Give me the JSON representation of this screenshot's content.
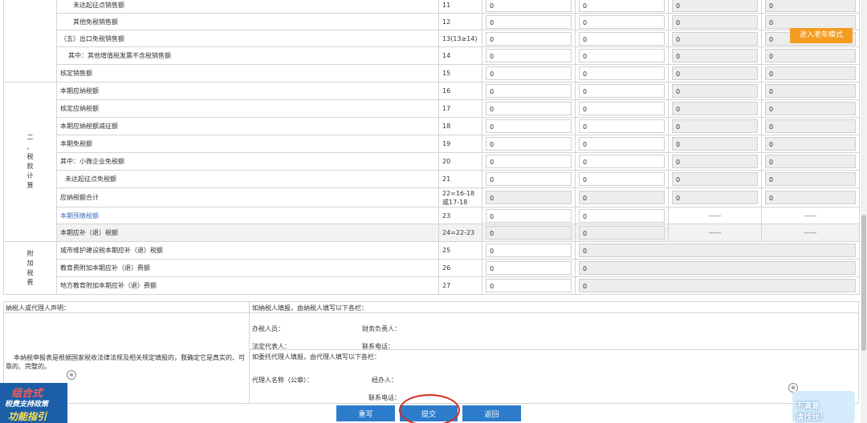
{
  "rows": [
    {
      "label": "未达起征点销售额",
      "indent": "ind1",
      "line": "11",
      "v1": "0",
      "v2": "0",
      "v3": "0",
      "v4": "0"
    },
    {
      "label": "其他免税销售额",
      "indent": "ind1",
      "line": "12",
      "v1": "0",
      "v2": "0",
      "v3": "0",
      "v4": "0"
    },
    {
      "label": "（五）出口免税销售额",
      "indent": "",
      "line": "13(13≥14)",
      "v1": "0",
      "v2": "0",
      "v3": "0",
      "v4": "0"
    },
    {
      "label": "其中：其他增值税发票不含税销售额",
      "indent": "ind2",
      "line": "14",
      "v1": "0",
      "v2": "0",
      "v3": "0",
      "v4": "0"
    },
    {
      "label": "核定销售额",
      "indent": "",
      "line": "15",
      "v1": "0",
      "v2": "0",
      "v3": "0",
      "v4": "0"
    },
    {
      "label": "本期应纳税额",
      "indent": "",
      "line": "16",
      "v1": "0",
      "v2": "0",
      "v3": "0",
      "v4": "0"
    },
    {
      "label": "核定应纳税额",
      "indent": "",
      "line": "17",
      "v1": "0",
      "v2": "0",
      "v3": "0",
      "v4": "0"
    },
    {
      "label": "本期应纳税额减征额",
      "indent": "",
      "line": "18",
      "v1": "0",
      "v2": "0",
      "v3": "0",
      "v4": "0"
    },
    {
      "label": "本期免税额",
      "indent": "",
      "line": "19",
      "v1": "0",
      "v2": "0",
      "v3": "0",
      "v4": "0"
    },
    {
      "label": "其中：小微企业免税额",
      "indent": "",
      "line": "20",
      "v1": "0",
      "v2": "0",
      "v3": "0",
      "v4": "0"
    },
    {
      "label": "未达起征点免税额",
      "indent": "ind0",
      "line": "21",
      "v1": "0",
      "v2": "0",
      "v3": "0",
      "v4": "0"
    },
    {
      "label": "应纳税额合计",
      "indent": "",
      "line": "22=16-18或17-18",
      "v1": "0",
      "v2": "0",
      "v3": "0",
      "v4": "0"
    },
    {
      "label": "本期预缴税额",
      "indent": "",
      "line": "23",
      "v1": "0",
      "v2": "0",
      "v3": "——",
      "v4": "——"
    },
    {
      "label": "本期应补（退）税额",
      "indent": "",
      "line": "24=22-23",
      "v1": "0",
      "v2": "0",
      "v3": "——",
      "v4": "——"
    },
    {
      "label": "城市维护建设税本期应补（退）税额",
      "indent": "",
      "line": "25",
      "v1": "0",
      "v2": "0"
    },
    {
      "label": "教育费附加本期应补（退）费额",
      "indent": "",
      "line": "26",
      "v1": "0",
      "v2": "0"
    },
    {
      "label": "地方教育附加本期应补（退）费额",
      "indent": "",
      "line": "27",
      "v1": "0",
      "v2": "0"
    }
  ],
  "sections": {
    "tax_calc": "二、税款计算",
    "surcharge": "附加税费"
  },
  "declaration": {
    "left_title": "纳税人或代理人声明：",
    "left_text": "本纳税申报表是根据国家税收法律法规及相关规定填报的，我确定它是真实的、可靠的、完整的。",
    "self_title": "如纳税人填报，由纳税人填写以下各栏：",
    "handler": "办税人员：",
    "finance": "财务负责人：",
    "legal": "法定代表人：",
    "phone1": "联系电话：",
    "agent_title": "如委托代理人填报，由代理人填写以下各栏：",
    "agent_name": "代理人名称（公章）：",
    "agent_handler": "经办人：",
    "phone2": "联系电话："
  },
  "buttons": {
    "reset": "重写",
    "submit": "提交",
    "back": "返回"
  },
  "elder_mode": "进入老年模式",
  "promo": {
    "line1": "组合式",
    "line2": "税费支持政策",
    "line3": "功能指引"
  },
  "feedback": {
    "line1": "不满意",
    "line2": "请找我！"
  },
  "close_glyph": "⊗"
}
